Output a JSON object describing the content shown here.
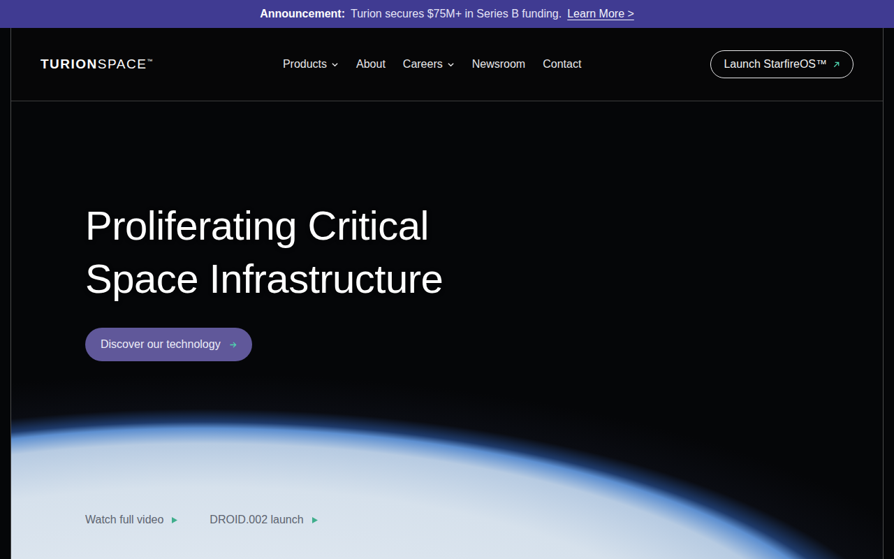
{
  "announcement": {
    "label": "Announcement:",
    "text": "Turion secures $75M+ in Series B funding.",
    "link": "Learn More >"
  },
  "logo": {
    "bold": "TURION",
    "light": "SPACE",
    "mark": "™"
  },
  "nav": [
    {
      "label": "Products",
      "dropdown": true
    },
    {
      "label": "About",
      "dropdown": false
    },
    {
      "label": "Careers",
      "dropdown": true
    },
    {
      "label": "Newsroom",
      "dropdown": false
    },
    {
      "label": "Contact",
      "dropdown": false
    }
  ],
  "launch_button": {
    "label": "Launch StarfireOS™"
  },
  "hero": {
    "title_lines": [
      "Proliferating Critical",
      "Space Infrastructure"
    ],
    "cta": "Discover our technology",
    "links": [
      "Watch full video",
      "DROID.002 launch"
    ]
  }
}
